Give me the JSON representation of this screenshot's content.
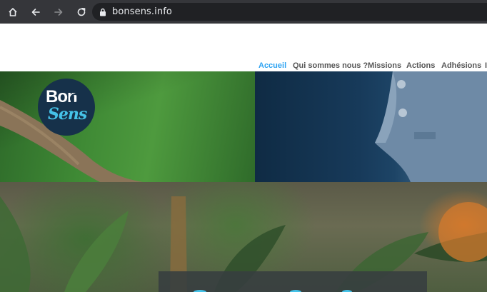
{
  "browser": {
    "url": "bonsens.info",
    "icons": [
      "home-icon",
      "back-arrow-icon",
      "forward-arrow-icon",
      "reload-icon",
      "lock-icon"
    ],
    "chrome_color": "#35363a",
    "urlbar_color": "#202124"
  },
  "site": {
    "logo": {
      "line1": "Bon",
      "line2": "Sens"
    },
    "menu": [
      {
        "label": "Accueil",
        "active": true
      },
      {
        "label": "Qui sommes nous ?",
        "active": false
      },
      {
        "label": "Missions",
        "active": false
      },
      {
        "label": "Actions",
        "active": false
      },
      {
        "label": "Adhésions",
        "active": false
      },
      {
        "label": "I",
        "active": false
      }
    ],
    "colors": {
      "menu_text": "#555555",
      "menu_active": "#2ea3f2",
      "logo_bg": "#16314a",
      "logo_accent": "#45c2e8"
    }
  }
}
